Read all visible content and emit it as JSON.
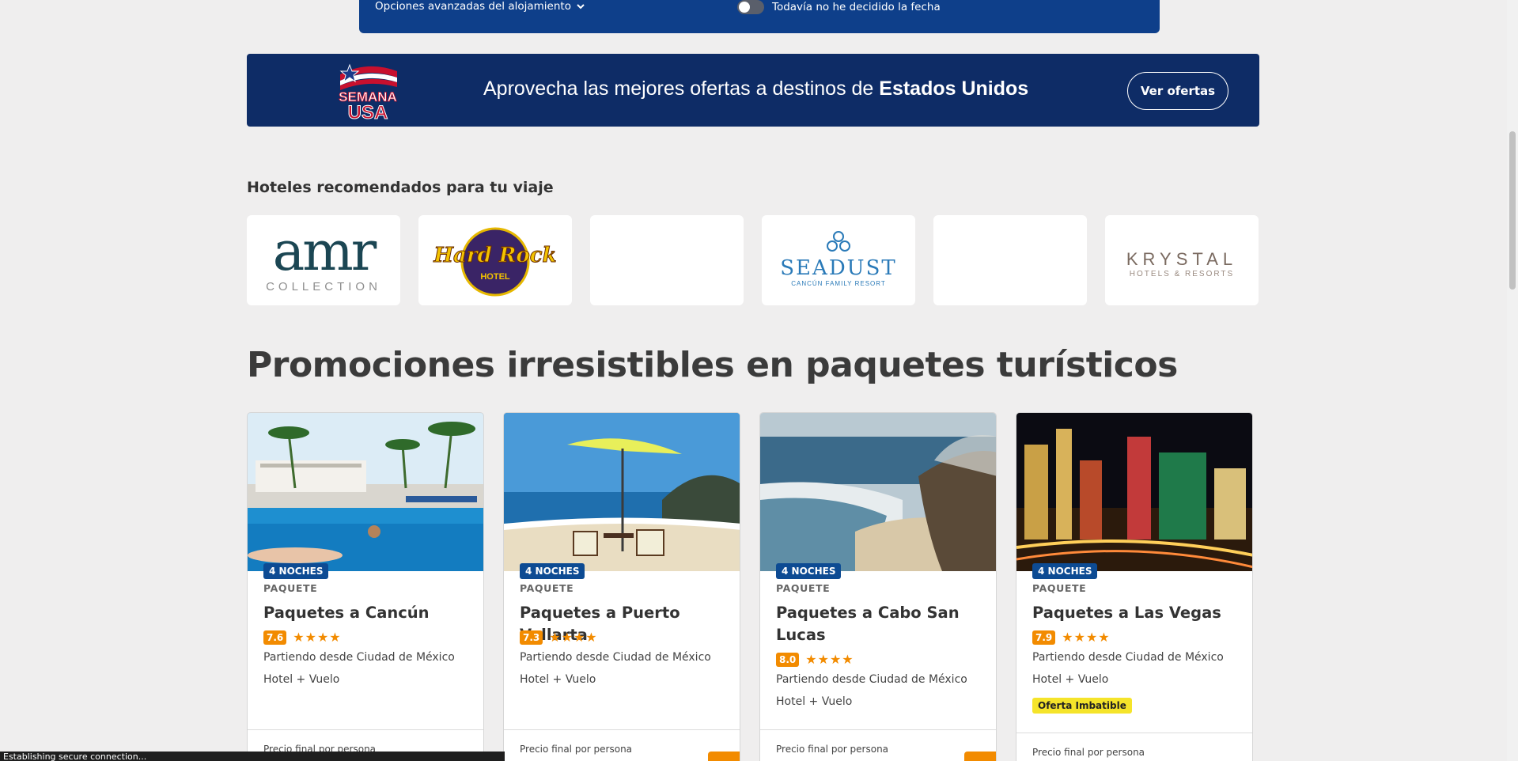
{
  "search": {
    "advanced_label": "Opciones avanzadas del alojamiento",
    "undecided_label": "Todavía no he decidido la fecha"
  },
  "banner": {
    "logo_alt": "SEMANA USA",
    "logo_top": "SEMANA",
    "logo_bottom": "USA",
    "text_prefix": "Aprovecha las mejores ofertas a destinos de ",
    "text_bold": "Estados Unidos",
    "button": "Ver ofertas",
    "bg_color": "#0e2c66"
  },
  "hotels": {
    "title": "Hoteles recomendados para tu viaje",
    "items": [
      {
        "name": "amr",
        "sub": "COLLECTION"
      },
      {
        "name": "Hard Rock",
        "sub": "HOTEL"
      },
      {
        "name": "",
        "sub": ""
      },
      {
        "name": "SEADUST",
        "sub": "CANCÚN FAMILY RESORT"
      },
      {
        "name": "",
        "sub": ""
      },
      {
        "name": "KRYSTAL",
        "sub": "HOTELS & RESORTS"
      }
    ]
  },
  "promos": {
    "title": "Promociones irresistibles en paquetes turísticos",
    "cards": [
      {
        "nights": "4 NOCHES",
        "kind": "PAQUETE",
        "title": "Paquetes a Cancún",
        "score": "7.6",
        "stars": 4,
        "origin": "Partiendo desde Ciudad de México",
        "type": "Hotel + Vuelo",
        "badge": "",
        "price_label": "Precio final por persona",
        "discount": ""
      },
      {
        "nights": "4 NOCHES",
        "kind": "PAQUETE",
        "title": "Paquetes a Puerto Vallarta",
        "score": "7.3",
        "stars": 4,
        "origin": "Partiendo desde Ciudad de México",
        "type": "Hotel + Vuelo",
        "badge": "",
        "price_label": "Precio final por persona",
        "discount": "-%"
      },
      {
        "nights": "4 NOCHES",
        "kind": "PAQUETE",
        "title": "Paquetes a Cabo San Lucas",
        "score": "8.0",
        "stars": 4,
        "origin": "Partiendo desde Ciudad de México",
        "type": "Hotel + Vuelo",
        "badge": "",
        "price_label": "Precio final por persona",
        "discount": "-%"
      },
      {
        "nights": "4 NOCHES",
        "kind": "PAQUETE",
        "title": "Paquetes a Las Vegas",
        "score": "7.9",
        "stars": 4,
        "origin": "Partiendo desde Ciudad de México",
        "type": "Hotel + Vuelo",
        "badge": "Oferta Imbatible",
        "price_label": "Precio final por persona",
        "discount": ""
      }
    ]
  },
  "status": {
    "text": "Establishing secure connection..."
  },
  "icons": {
    "chevron": "chevron-down-icon",
    "star": "star-icon"
  },
  "colors": {
    "accent": "#f28b00",
    "primary": "#0d4b93",
    "imbatible": "#f5e42a"
  }
}
